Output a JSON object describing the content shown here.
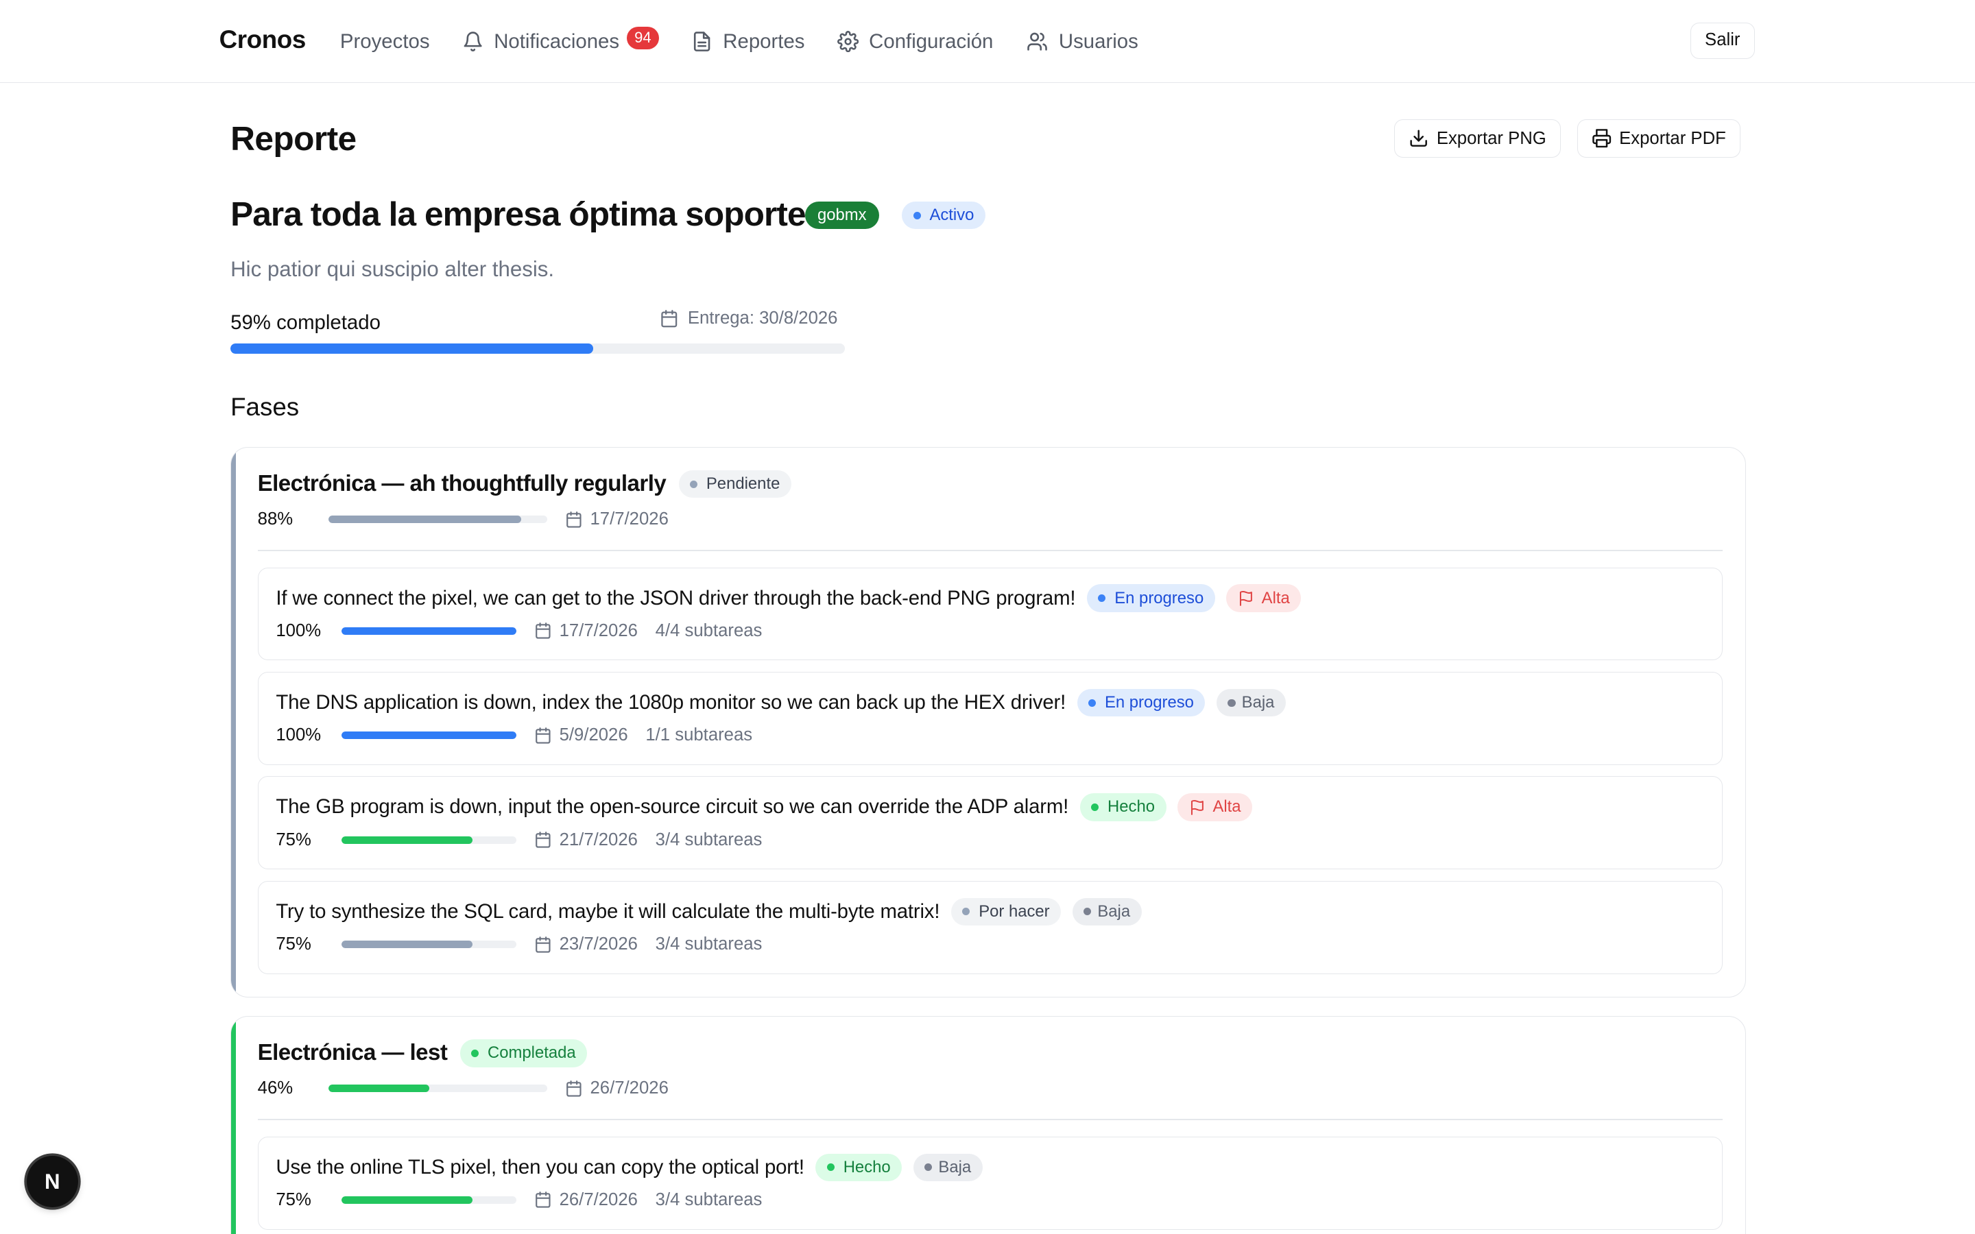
{
  "nav": {
    "brand": "Cronos",
    "items": [
      {
        "label": "Proyectos",
        "icon": "none"
      },
      {
        "label": "Notificaciones",
        "icon": "bell-icon",
        "badge": "94"
      },
      {
        "label": "Reportes",
        "icon": "document-icon"
      },
      {
        "label": "Configuración",
        "icon": "gear-icon"
      },
      {
        "label": "Usuarios",
        "icon": "users-icon"
      }
    ],
    "logout": "Salir"
  },
  "header": {
    "title": "Reporte",
    "export_png": "Exportar PNG",
    "export_pdf": "Exportar PDF"
  },
  "project": {
    "title": "Para toda la empresa óptima soporte",
    "client": "gobmx",
    "status": "Activo",
    "description": "Hic patior qui suscipio alter thesis.",
    "progress_label": "59% completado",
    "progress": 0.59,
    "due": "Entrega: 30/8/2026"
  },
  "phases_title": "Fases",
  "phases": [
    {
      "name": "Electrónica — ah thoughtfully regularly",
      "status": "Pendiente",
      "accent": "#94a3b8",
      "pct": "88%",
      "progress": 0.88,
      "date": "17/7/2026",
      "tasks": [
        {
          "title": "If we connect the pixel, we can get to the JSON driver through the back-end PNG program!",
          "status": "En progreso",
          "priority": "Alta",
          "pct": "100%",
          "progress": 1.0,
          "date": "17/7/2026",
          "subtasks": "4/4 subtareas",
          "bar_color": "#2f7cf6"
        },
        {
          "title": "The DNS application is down, index the 1080p monitor so we can back up the HEX driver!",
          "status": "En progreso",
          "priority": "Baja",
          "pct": "100%",
          "progress": 1.0,
          "date": "5/9/2026",
          "subtasks": "1/1 subtareas",
          "bar_color": "#2f7cf6"
        },
        {
          "title": "The GB program is down, input the open-source circuit so we can override the ADP alarm!",
          "status": "Hecho",
          "priority": "Alta",
          "pct": "75%",
          "progress": 0.75,
          "date": "21/7/2026",
          "subtasks": "3/4 subtareas",
          "bar_color": "#22c55e"
        },
        {
          "title": "Try to synthesize the SQL card, maybe it will calculate the multi-byte matrix!",
          "status": "Por hacer",
          "priority": "Baja",
          "pct": "75%",
          "progress": 0.75,
          "date": "23/7/2026",
          "subtasks": "3/4 subtareas",
          "bar_color": "#94a3b8"
        }
      ]
    },
    {
      "name": "Electrónica — lest",
      "status": "Completada",
      "accent": "#22c55e",
      "pct": "46%",
      "progress": 0.46,
      "date": "26/7/2026",
      "tasks": [
        {
          "title": "Use the online TLS pixel, then you can copy the optical port!",
          "status": "Hecho",
          "priority": "Baja",
          "pct": "75%",
          "progress": 0.75,
          "date": "26/7/2026",
          "subtasks": "3/4 subtareas",
          "bar_color": "#22c55e"
        }
      ]
    }
  ],
  "dev_badge": "N"
}
